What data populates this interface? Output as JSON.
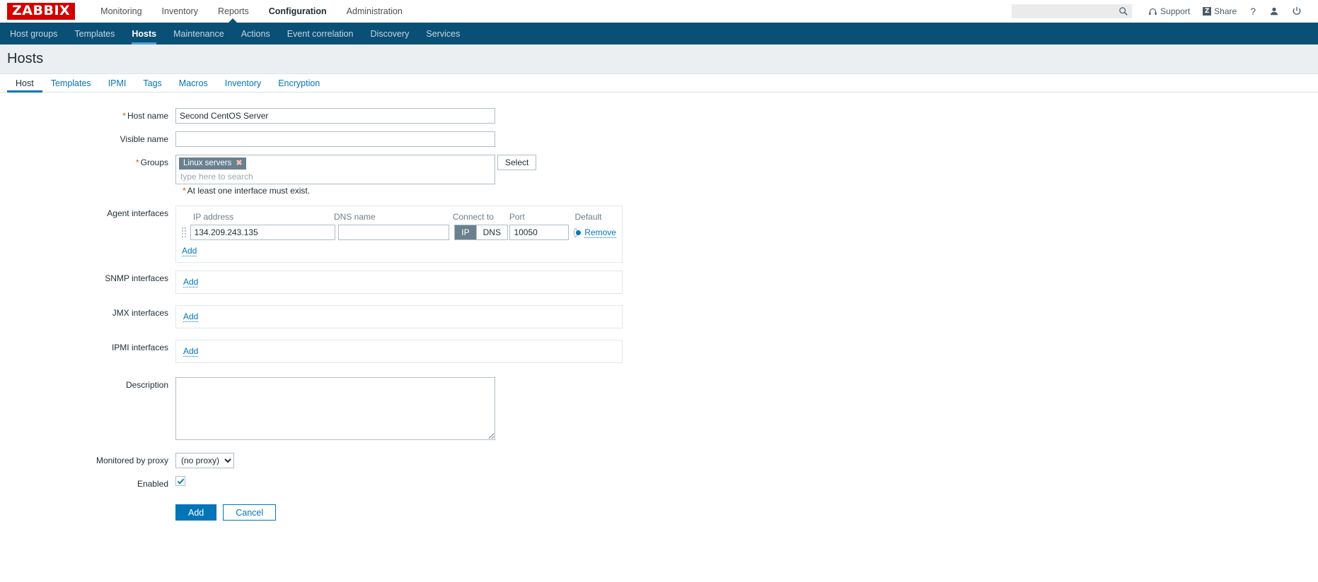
{
  "header": {
    "logo": "ZABBIX",
    "nav": [
      {
        "label": "Monitoring",
        "active": false
      },
      {
        "label": "Inventory",
        "active": false
      },
      {
        "label": "Reports",
        "active": false
      },
      {
        "label": "Configuration",
        "active": true
      },
      {
        "label": "Administration",
        "active": false
      }
    ],
    "search_placeholder": "",
    "search_value": "",
    "support_label": "Support",
    "share_label": "Share",
    "share_badge": "Z",
    "help_label": "?",
    "user_icon": "user-icon",
    "signout_icon": "power-icon"
  },
  "subnav": {
    "items": [
      {
        "label": "Host groups",
        "active": false
      },
      {
        "label": "Templates",
        "active": false
      },
      {
        "label": "Hosts",
        "active": true
      },
      {
        "label": "Maintenance",
        "active": false
      },
      {
        "label": "Actions",
        "active": false
      },
      {
        "label": "Event correlation",
        "active": false
      },
      {
        "label": "Discovery",
        "active": false
      },
      {
        "label": "Services",
        "active": false
      }
    ]
  },
  "page": {
    "title": "Hosts"
  },
  "form_tabs": [
    {
      "label": "Host",
      "active": true
    },
    {
      "label": "Templates",
      "active": false
    },
    {
      "label": "IPMI",
      "active": false
    },
    {
      "label": "Tags",
      "active": false
    },
    {
      "label": "Macros",
      "active": false
    },
    {
      "label": "Inventory",
      "active": false
    },
    {
      "label": "Encryption",
      "active": false
    }
  ],
  "form": {
    "host_name": {
      "label": "Host name",
      "required": true,
      "value": "Second CentOS Server",
      "placeholder": ""
    },
    "visible_name": {
      "label": "Visible name",
      "required": false,
      "value": "",
      "placeholder": ""
    },
    "groups": {
      "label": "Groups",
      "required": true,
      "chips": [
        {
          "label": "Linux servers",
          "remove_icon": "close-icon"
        }
      ],
      "search_placeholder": "type here to search",
      "search_value": "",
      "select_button": "Select"
    },
    "interface_note": "At least one interface must exist.",
    "agent_interfaces": {
      "label": "Agent interfaces",
      "columns": {
        "ip": "IP address",
        "dns": "DNS name",
        "connect_to": "Connect to",
        "port": "Port",
        "default": "Default"
      },
      "rows": [
        {
          "ip": "134.209.243.135",
          "dns": "",
          "connect_to": "IP",
          "connect_options": [
            "IP",
            "DNS"
          ],
          "port": "10050",
          "is_default": true,
          "remove_label": "Remove"
        }
      ],
      "add_label": "Add"
    },
    "snmp_interfaces": {
      "label": "SNMP interfaces",
      "add_label": "Add"
    },
    "jmx_interfaces": {
      "label": "JMX interfaces",
      "add_label": "Add"
    },
    "ipmi_interfaces": {
      "label": "IPMI interfaces",
      "add_label": "Add"
    },
    "description": {
      "label": "Description",
      "value": "",
      "placeholder": ""
    },
    "monitored_by_proxy": {
      "label": "Monitored by proxy",
      "value": "(no proxy)",
      "options": [
        "(no proxy)"
      ]
    },
    "enabled": {
      "label": "Enabled",
      "checked": true
    },
    "actions": {
      "submit": "Add",
      "cancel": "Cancel"
    }
  },
  "colors": {
    "brand_red": "#d40000",
    "subnav_blue": "#0a4f76",
    "accent_blue": "#0275b8",
    "chip_gray": "#69808f",
    "required_orange": "#d35400"
  }
}
